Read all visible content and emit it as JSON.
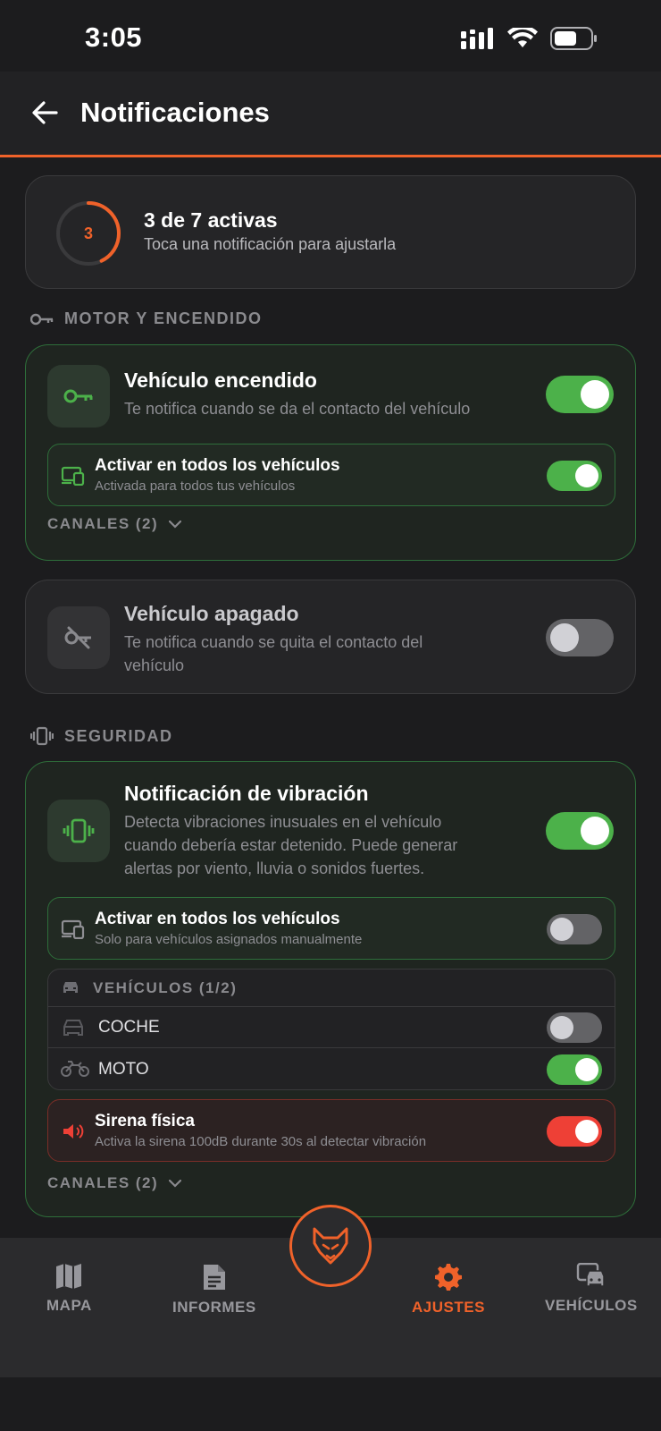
{
  "status_bar": {
    "time": "3:05"
  },
  "header": {
    "title": "Notificaciones"
  },
  "summary": {
    "active_count": "3",
    "title": "3 de 7 activas",
    "subtitle": "Toca una notificación para ajustarla",
    "active": 3,
    "total": 7
  },
  "sections": {
    "motor": {
      "label": "MOTOR Y ENCENDIDO"
    },
    "security": {
      "label": "SEGURIDAD"
    }
  },
  "notifications": {
    "on": {
      "title": "Vehículo encendido",
      "description": "Te notifica cuando se da el contacto del vehículo",
      "enabled": true,
      "all_vehicles": {
        "title": "Activar en todos los vehículos",
        "subtitle": "Activada para todos tus vehículos",
        "enabled": true
      },
      "channels": "CANALES (2)"
    },
    "off": {
      "title": "Vehículo apagado",
      "description_line1": "Te notifica cuando se quita el contacto del",
      "description_line2": "vehículo",
      "enabled": false
    },
    "vibration": {
      "title": "Notificación de vibración",
      "description_line1": "Detecta vibraciones inusuales en el vehículo",
      "description_line2": "cuando debería estar detenido. Puede generar",
      "description_line3": "alertas por viento, lluvia o sonidos fuertes.",
      "enabled": true,
      "all_vehicles": {
        "title": "Activar en todos los vehículos",
        "subtitle": "Solo para vehículos asignados manualmente",
        "enabled": false
      },
      "vehicles": {
        "header": "VEHÍCULOS (1/2)",
        "items": [
          {
            "name": "COCHE",
            "enabled": false
          },
          {
            "name": "MOTO",
            "enabled": true
          }
        ]
      },
      "siren": {
        "title": "Sirena física",
        "subtitle": "Activa la sirena 100dB durante 30s al detectar vibración",
        "enabled": true
      },
      "channels": "CANALES (2)"
    }
  },
  "nav": {
    "items": [
      {
        "label": "MAPA",
        "icon": "map-icon"
      },
      {
        "label": "INFORMES",
        "icon": "document-icon"
      },
      {
        "label": "AJUSTES",
        "icon": "gear-icon",
        "active": true
      },
      {
        "label": "VEHÍCULOS",
        "icon": "vehicles-icon"
      }
    ],
    "fab_icon": "wolf-logo-icon"
  },
  "colors": {
    "accent": "#f0622a",
    "toggle_on": "#4cb14a",
    "toggle_off": "#636366",
    "danger": "#ee4036",
    "background": "#1c1c1e"
  }
}
